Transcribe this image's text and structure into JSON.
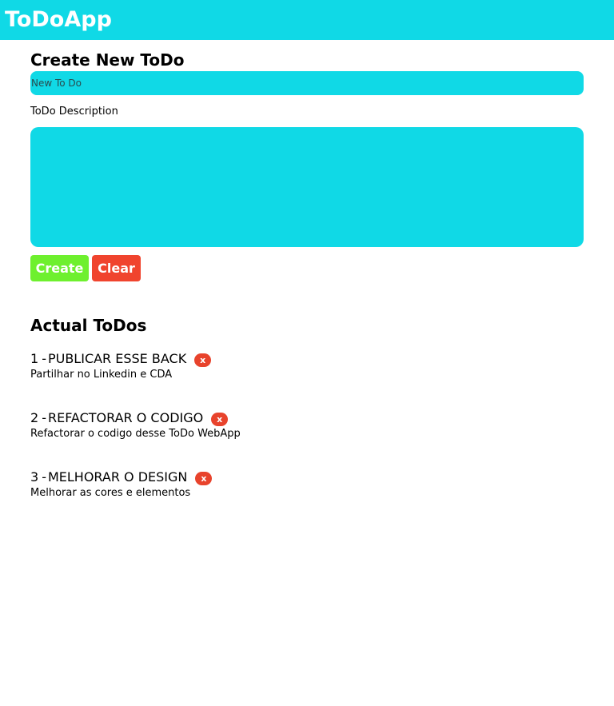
{
  "app": {
    "title": "ToDoApp"
  },
  "create": {
    "heading": "Create New ToDo",
    "title_placeholder": "New To Do",
    "title_value": "",
    "description_label": "ToDo Description",
    "description_value": "",
    "create_label": "Create",
    "clear_label": "Clear"
  },
  "list": {
    "heading": "Actual ToDos",
    "todos": [
      {
        "number": "1",
        "sep": "-",
        "title": "PUBLICAR ESSE BACK",
        "description": "Partilhar no Linkedin e CDA",
        "delete_label": "x"
      },
      {
        "number": "2",
        "sep": "-",
        "title": "REFACTORAR O CODIGO",
        "description": "Refactorar o codigo desse ToDo WebApp",
        "delete_label": "x"
      },
      {
        "number": "3",
        "sep": "-",
        "title": "MELHORAR O DESIGN",
        "description": "Melhorar as cores e elementos",
        "delete_label": "x"
      }
    ]
  },
  "colors": {
    "accent": "#10d9e6",
    "create_button": "#6ef02e",
    "clear_button": "#f0442e",
    "delete_button": "#e8432c"
  }
}
